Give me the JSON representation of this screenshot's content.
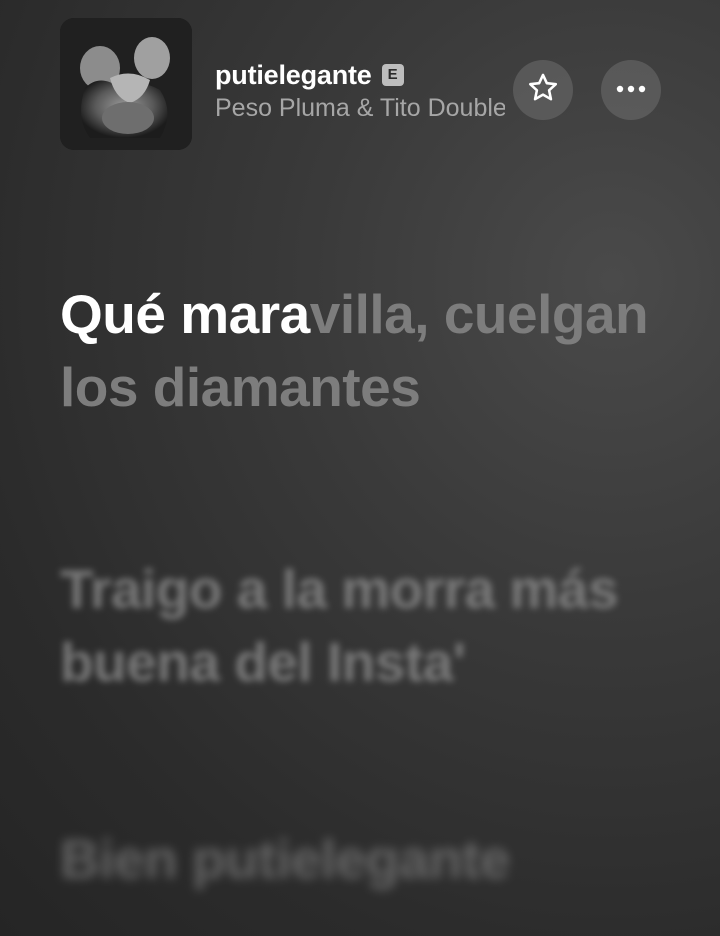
{
  "now_playing": {
    "title": "putielegante",
    "explicit_badge": "E",
    "artist": "Peso Pluma & Tito Double P",
    "star_icon": "star-icon",
    "more_icon": "more-horizontal-icon"
  },
  "lyrics": {
    "current_sung": "Qué mara",
    "current_rest": "villa, cuelgan los diamantes",
    "next": "Traigo a la morra más buena del Insta'",
    "upcoming": "Bien putielegante"
  }
}
